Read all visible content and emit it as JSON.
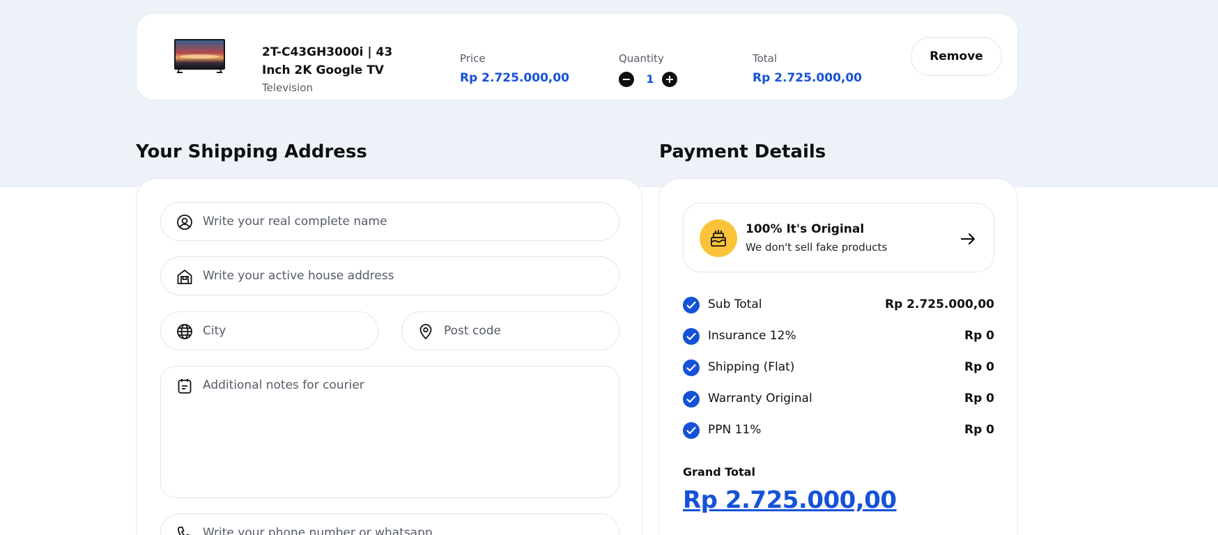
{
  "cart": {
    "item": {
      "name": "2T-C43GH3000i | 43 Inch 2K Google TV",
      "category": "Television",
      "price_label": "Price",
      "price": "Rp 2.725.000,00",
      "quantity_label": "Quantity",
      "quantity": "1",
      "total_label": "Total",
      "total": "Rp 2.725.000,00",
      "remove_label": "Remove",
      "minus_symbol": "−",
      "plus_symbol": "+"
    }
  },
  "shipping": {
    "title": "Your Shipping Address",
    "fields": {
      "name_placeholder": "Write your real complete name",
      "address_placeholder": "Write your active house address",
      "city_placeholder": "City",
      "postcode_placeholder": "Post code",
      "notes_placeholder": "Additional notes for courier",
      "phone_placeholder": "Write your phone number or whatsapp"
    },
    "icons": [
      "user-icon",
      "house-icon",
      "globe-icon",
      "map-pin-icon",
      "note-icon",
      "phone-icon"
    ]
  },
  "payment": {
    "title": "Payment Details",
    "promo": {
      "title": "100% It's Original",
      "subtitle": "We don't sell fake products",
      "icon": "cake-icon",
      "accent": "#fcc33a"
    },
    "items": [
      {
        "label": "Sub Total",
        "value": "Rp 2.725.000,00"
      },
      {
        "label": "Insurance 12%",
        "value": "Rp 0"
      },
      {
        "label": "Shipping (Flat)",
        "value": "Rp 0"
      },
      {
        "label": "Warranty Original",
        "value": "Rp 0"
      },
      {
        "label": "PPN 11%",
        "value": "Rp 0"
      }
    ],
    "grand_total_label": "Grand Total",
    "grand_total": "Rp 2.725.000,00"
  },
  "colors": {
    "accent_blue": "#1652d8",
    "page_bg_top": "#edf2f9",
    "promo_yellow": "#fcc33a"
  }
}
